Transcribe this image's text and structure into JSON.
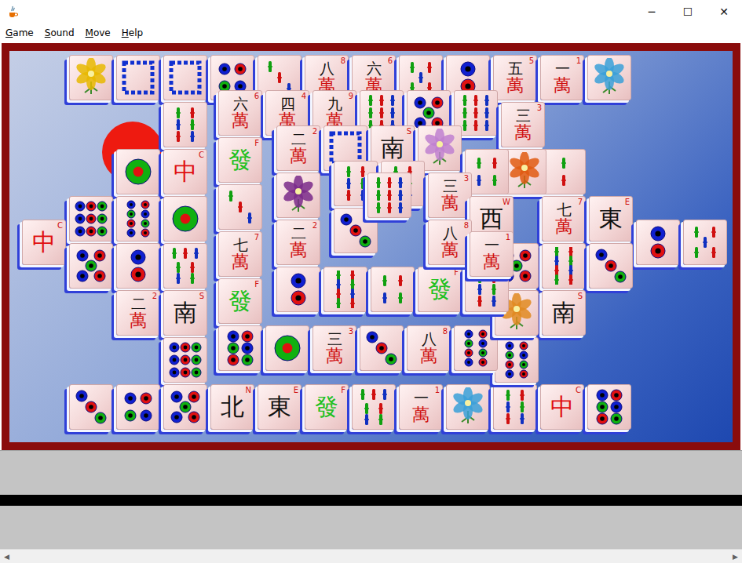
{
  "window": {
    "title": "",
    "controls": [
      "─",
      "☐",
      "✕"
    ]
  },
  "menu": [
    {
      "label": "Game"
    },
    {
      "label": "Sound"
    },
    {
      "label": "Move"
    },
    {
      "label": "Help"
    }
  ],
  "tiles": [
    {
      "kind": "picture",
      "color": "#e8b800"
    },
    {
      "kind": "white"
    },
    {
      "kind": "white"
    },
    {
      "kind": "dots",
      "count": 4
    },
    {
      "kind": "bamboo",
      "count": 3
    },
    {
      "kind": "character",
      "rank": "八",
      "suit": "萬",
      "index": "8"
    },
    {
      "kind": "character",
      "rank": "六",
      "suit": "萬",
      "index": "6"
    },
    {
      "kind": "bamboo",
      "count": 5
    },
    {
      "kind": "dots",
      "count": 2
    },
    {
      "kind": "character",
      "rank": "五",
      "suit": "萬",
      "index": "5"
    },
    {
      "kind": "character",
      "rank": "一",
      "suit": "萬",
      "index": "1"
    },
    {
      "kind": "picture",
      "color": "#3aa0d8"
    },
    {
      "kind": "bamboo",
      "count": 6
    },
    {
      "kind": "dots",
      "count": 1
    },
    {
      "kind": "honor",
      "glyph": "中",
      "index": "C",
      "color": "#e01010"
    },
    {
      "kind": "dots",
      "count": 9
    },
    {
      "kind": "dots",
      "count": 8
    },
    {
      "kind": "dots",
      "count": 1
    },
    {
      "kind": "honor",
      "glyph": "中",
      "index": "C",
      "color": "#e01010"
    },
    {
      "kind": "dots",
      "count": 5
    },
    {
      "kind": "dots",
      "count": 2
    },
    {
      "kind": "bamboo",
      "count": 7
    },
    {
      "kind": "character",
      "rank": "二",
      "suit": "萬",
      "index": "2"
    },
    {
      "kind": "honor",
      "glyph": "南",
      "index": "S",
      "color": "#111111"
    },
    {
      "kind": "dots",
      "count": 9
    },
    {
      "kind": "dots",
      "count": 3
    },
    {
      "kind": "dots",
      "count": 4
    },
    {
      "kind": "dots",
      "count": 5
    },
    {
      "kind": "honor",
      "glyph": "北",
      "index": "N",
      "color": "#111111"
    },
    {
      "kind": "honor",
      "glyph": "東",
      "index": "E",
      "color": "#111111"
    },
    {
      "kind": "honor",
      "glyph": "發",
      "index": "F",
      "color": "#20c020"
    },
    {
      "kind": "bamboo",
      "count": 7
    },
    {
      "kind": "character",
      "rank": "一",
      "suit": "萬",
      "index": "1"
    },
    {
      "kind": "picture",
      "color": "#3aa0d8"
    },
    {
      "kind": "bamboo",
      "count": 6
    },
    {
      "kind": "honor",
      "glyph": "中",
      "index": "C",
      "color": "#e01010"
    },
    {
      "kind": "dots",
      "count": 6
    },
    {
      "kind": "bamboo",
      "count": 2
    },
    {
      "kind": "character",
      "rank": "七",
      "suit": "萬",
      "index": "7"
    },
    {
      "kind": "honor",
      "glyph": "東",
      "index": "E",
      "color": "#111111"
    },
    {
      "kind": "dots",
      "count": 2
    },
    {
      "kind": "bamboo",
      "count": 5
    },
    {
      "kind": "bamboo",
      "count": 8
    },
    {
      "kind": "dots",
      "count": 3
    },
    {
      "kind": "honor",
      "glyph": "南",
      "index": "S",
      "color": "#111111"
    },
    {
      "kind": "dots",
      "count": 8
    },
    {
      "kind": "character",
      "rank": "六",
      "suit": "萬",
      "index": "6"
    },
    {
      "kind": "character",
      "rank": "四",
      "suit": "萬",
      "index": "4"
    },
    {
      "kind": "character",
      "rank": "九",
      "suit": "萬",
      "index": "9"
    },
    {
      "kind": "bamboo",
      "count": 9
    },
    {
      "kind": "dots",
      "count": 5
    },
    {
      "kind": "bamboo",
      "count": 9
    },
    {
      "kind": "character",
      "rank": "三",
      "suit": "萬",
      "index": "3"
    },
    {
      "kind": "honor",
      "glyph": "發",
      "index": "F",
      "color": "#20c020"
    },
    {
      "kind": "bamboo",
      "count": 3
    },
    {
      "kind": "character",
      "rank": "七",
      "suit": "萬",
      "index": "7"
    },
    {
      "kind": "honor",
      "glyph": "發",
      "index": "F",
      "color": "#20c020"
    },
    {
      "kind": "dots",
      "count": 6
    },
    {
      "kind": "dots",
      "count": 1
    },
    {
      "kind": "character",
      "rank": "三",
      "suit": "萬",
      "index": "3"
    },
    {
      "kind": "dots",
      "count": 3
    },
    {
      "kind": "character",
      "rank": "八",
      "suit": "萬",
      "index": "8"
    },
    {
      "kind": "dots",
      "count": 8
    },
    {
      "kind": "picture",
      "color": "#e05a10"
    },
    {
      "kind": "dots",
      "count": 5
    },
    {
      "kind": "picture",
      "color": "#e08a20"
    },
    {
      "kind": "character",
      "rank": "二",
      "suit": "萬",
      "index": "2"
    },
    {
      "kind": "white"
    },
    {
      "kind": "honor",
      "glyph": "南",
      "index": "S",
      "color": "#111111"
    },
    {
      "kind": "picture",
      "color": "#c080d0"
    },
    {
      "kind": "picture",
      "color": "#7a2a8a"
    },
    {
      "kind": "character",
      "rank": "二",
      "suit": "萬",
      "index": "2"
    },
    {
      "kind": "dots",
      "count": 2
    },
    {
      "kind": "bamboo",
      "count": 8
    },
    {
      "kind": "bamboo",
      "count": 4
    },
    {
      "kind": "honor",
      "glyph": "發",
      "index": "F",
      "color": "#20c020"
    },
    {
      "kind": "bamboo",
      "count": 6
    },
    {
      "kind": "bamboo",
      "count": 4
    },
    {
      "kind": "bamboo",
      "count": 6
    },
    {
      "kind": "bamboo",
      "count": 6
    },
    {
      "kind": "character",
      "rank": "三",
      "suit": "萬",
      "index": "3"
    },
    {
      "kind": "honor",
      "glyph": "西",
      "index": "W",
      "color": "#111111"
    },
    {
      "kind": "dots",
      "count": 3
    },
    {
      "kind": "character",
      "rank": "八",
      "suit": "萬",
      "index": "8"
    },
    {
      "kind": "character",
      "rank": "一",
      "suit": "萬",
      "index": "1"
    },
    {
      "kind": "bamboo",
      "count": 9
    }
  ],
  "scrollbar": {
    "left": "◀",
    "right": "▶"
  }
}
